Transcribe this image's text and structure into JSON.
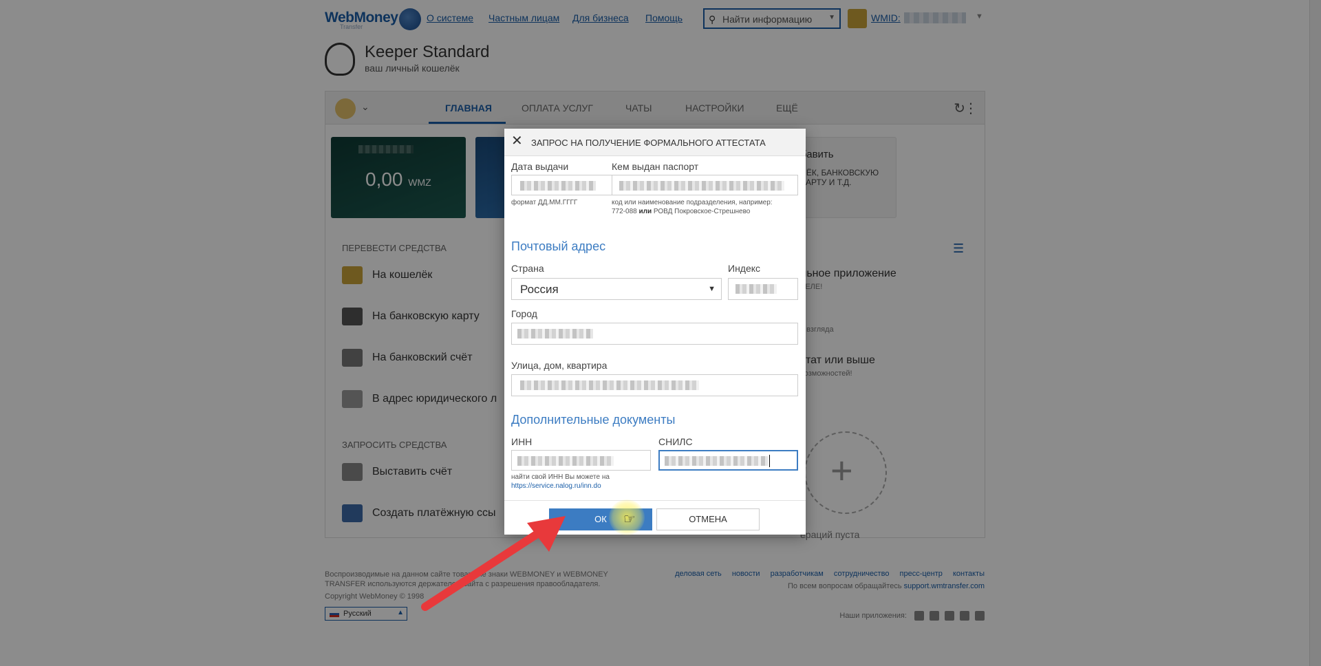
{
  "header": {
    "logo": "WebMoney",
    "logo_sub": "Transfer",
    "nav": [
      "О системе",
      "Частным лицам",
      "Для бизнеса",
      "Помощь"
    ],
    "search_placeholder": "Найти информацию",
    "wmid_label": "WMID:"
  },
  "keeper": {
    "title": "Keeper Standard",
    "subtitle": "ваш личный кошелёк"
  },
  "tabs": [
    "ГЛАВНАЯ",
    "ОПЛАТА УСЛУГ",
    "ЧАТЫ",
    "НАСТРОЙКИ",
    "ЕЩЁ"
  ],
  "wallet": {
    "amount": "0,00",
    "currency": "WMZ"
  },
  "promo_card": {
    "title": "бавить",
    "desc": "ЛЁК, БАНКОВСКУЮ КАРТУ И Т.Д."
  },
  "transfer": {
    "heading": "ПЕРЕВЕСТИ СРЕДСТВА",
    "items": [
      "На кошелёк",
      "На банковскую карту",
      "На банковский счёт",
      "В адрес юридического л"
    ]
  },
  "request": {
    "heading": "ЗАПРОСИТЬ СРЕДСТВА",
    "items": [
      "Выставить счёт",
      "Создать платёжную ссы"
    ]
  },
  "right_panel": {
    "line1": "льное приложение",
    "line1_sub": "ВЕЛЕ!",
    "line2_sub": "о взгляда",
    "line3": "стат или выше",
    "line3_sub": "возможностей!",
    "empty": "ераций пуста"
  },
  "footer": {
    "left": "Воспроизводимые на данном сайте товарные знаки WEBMONEY и WEBMONEY TRANSFER используются держателем сайта с разрешения правообладателя.",
    "copyright": "Copyright WebMoney © 1998",
    "links": [
      "деловая сеть",
      "новости",
      "разработчикам",
      "сотрудничество",
      "пресс-центр",
      "контакты"
    ],
    "support_prefix": "По всем вопросам обращайтесь",
    "support_link": "support.wmtransfer.com",
    "language": "Русский",
    "apps_label": "Наши приложения:"
  },
  "modal": {
    "title": "ЗАПРОС НА ПОЛУЧЕНИЕ ФОРМАЛЬНОГО АТТЕСТАТА",
    "issue_date_label": "Дата выдачи",
    "issue_date_hint": "формат ДД.ММ.ГГГГ",
    "issued_by_label": "Кем выдан паспорт",
    "issued_by_hint1": "код или наименование подразделения, например:",
    "issued_by_hint_code": "772-088",
    "issued_by_hint_or": "или",
    "issued_by_hint_name": "РОВД Покровское-Стрешнево",
    "postal_title": "Почтовый адрес",
    "country_label": "Страна",
    "country_value": "Россия",
    "index_label": "Индекс",
    "city_label": "Город",
    "street_label": "Улица, дом, квартира",
    "extra_title": "Дополнительные документы",
    "inn_label": "ИНН",
    "inn_hint": "найти свой ИНН Вы можете на",
    "inn_link": "https://service.nalog.ru/inn.do",
    "snils_label": "СНИЛС",
    "ok": "ОК",
    "cancel": "ОТМЕНА"
  },
  "colors": {
    "accent": "#3c7cc2",
    "brand": "#1a5ea8",
    "arrow": "#e8393b"
  }
}
